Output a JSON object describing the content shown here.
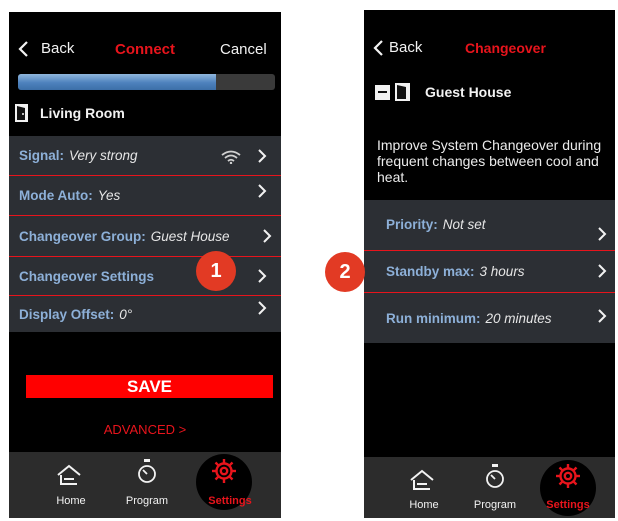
{
  "colors": {
    "accent": "#e8141c",
    "label_blue": "#8db0d8",
    "menu_bg": "#2c2f34",
    "badge": "#e23a24"
  },
  "screen1": {
    "back_label": "Back",
    "title": "Connect",
    "cancel_label": "Cancel",
    "progress_fraction": 0.77,
    "room_name": "Living Room",
    "menu": [
      {
        "label": "Signal:",
        "value": "Very strong",
        "icon": "wifi-icon"
      },
      {
        "label": "Mode Auto:",
        "value": "Yes"
      },
      {
        "label": "Changeover Group:",
        "value": "Guest House"
      },
      {
        "label": "Changeover Settings",
        "value": ""
      },
      {
        "label": "Display Offset:",
        "value": "0°"
      }
    ],
    "save_label": "SAVE",
    "advanced_label": "ADVANCED >",
    "tabs": [
      {
        "label": "Home",
        "icon": "home-icon"
      },
      {
        "label": "Program",
        "icon": "timer-icon"
      },
      {
        "label": "Settings",
        "icon": "gear-icon"
      }
    ],
    "badge": "1"
  },
  "screen2": {
    "back_label": "Back",
    "title": "Changeover",
    "room_name": "Guest House",
    "description": "Improve System Changeover during frequent changes between cool and heat.",
    "menu": [
      {
        "label": "Priority:",
        "value": "Not set"
      },
      {
        "label": "Standby max:",
        "value": "3 hours"
      },
      {
        "label": "Run minimum:",
        "value": "20 minutes"
      }
    ],
    "tabs": [
      {
        "label": "Home",
        "icon": "home-icon"
      },
      {
        "label": "Program",
        "icon": "timer-icon"
      },
      {
        "label": "Settings",
        "icon": "gear-icon"
      }
    ],
    "badge": "2"
  }
}
